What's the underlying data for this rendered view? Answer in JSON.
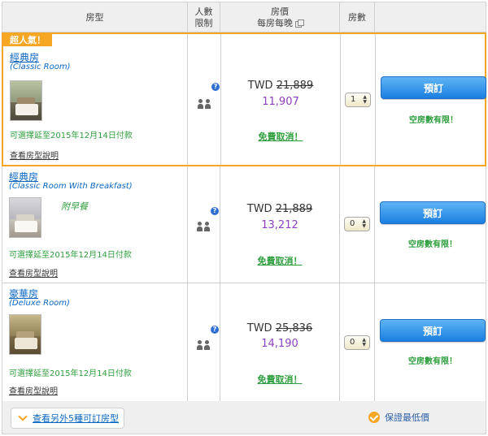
{
  "header": {
    "room_type": "房型",
    "occupancy": [
      "人數",
      "限制"
    ],
    "price": "房價",
    "price_sub": "每房每晚",
    "rooms": "房數"
  },
  "rooms": [
    {
      "badge": "超人氣！",
      "name": "經典房",
      "name_en": "(Classic Room)",
      "breakfast": "",
      "pay_note": "可選擇延至2015年12月14日付款",
      "details": "查看房型說明",
      "currency": "TWD",
      "old_price": "21,889",
      "new_price": "11,907",
      "cancel": "免費取消！",
      "qty": "1",
      "book": "預訂",
      "availability": "空房數有限！"
    },
    {
      "badge": "",
      "name": "經典房",
      "name_en": "(Classic Room With Breakfast)",
      "breakfast": "附早餐",
      "pay_note": "可選擇延至2015年12月14日付款",
      "details": "查看房型說明",
      "currency": "TWD",
      "old_price": "21,889",
      "new_price": "13,212",
      "cancel": "免費取消！",
      "qty": "0",
      "book": "預訂",
      "availability": "空房數有限！"
    },
    {
      "badge": "",
      "name": "豪華房",
      "name_en": "(Deluxe Room)",
      "breakfast": "",
      "pay_note": "可選擇延至2015年12月14日付款",
      "details": "查看房型說明",
      "currency": "TWD",
      "old_price": "25,836",
      "new_price": "14,190",
      "cancel": "免費取消！",
      "qty": "0",
      "book": "預訂",
      "availability": "空房數有限！"
    }
  ],
  "footer": {
    "more_rooms": "查看另外5種可訂房型",
    "guarantee": "保證最低價"
  },
  "colors": {
    "accent": "#f5a623",
    "link": "#0a66c2",
    "green": "#2e9e3e",
    "price": "#8e3fbf",
    "button": "#1b7fe0"
  }
}
